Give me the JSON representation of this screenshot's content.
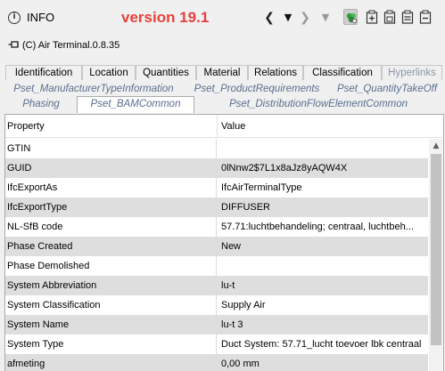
{
  "header": {
    "title": "INFO",
    "version": "version 19.1",
    "nav": {
      "back_glyph": "❮",
      "dropdown1_glyph": "▼",
      "forward_glyph": "❯",
      "dropdown2_glyph": "▼"
    },
    "tool_icons": [
      "color-picker-icon",
      "add-property-icon",
      "save-icon",
      "print-icon",
      "delete-icon"
    ]
  },
  "element": {
    "icon": "air-terminal-icon",
    "name": "(C) Air Terminal.0.8.35"
  },
  "tabs": {
    "row1": [
      "Identification",
      "Location",
      "Quantities",
      "Material",
      "Relations",
      "Classification",
      "Hyperlinks"
    ],
    "row2": [
      "Pset_ManufacturerTypeInformation",
      "Pset_ProductRequirements",
      "Pset_QuantityTakeOff"
    ],
    "row3": [
      "Phasing",
      "Pset_BAMCommon",
      "Pset_DistributionFlowElementCommon"
    ],
    "selected": "Pset_BAMCommon"
  },
  "table": {
    "columns": [
      "Property",
      "Value"
    ],
    "rows": [
      {
        "property": "GTIN",
        "value": ""
      },
      {
        "property": "GUID",
        "value": "0lNnw2$7L1x8aJz8yAQW4X"
      },
      {
        "property": "IfcExportAs",
        "value": "IfcAirTerminalType"
      },
      {
        "property": "IfcExportType",
        "value": "DIFFUSER"
      },
      {
        "property": "NL-SfB code",
        "value": "57.71:luchtbehandeling; centraal, luchtbeh..."
      },
      {
        "property": "Phase Created",
        "value": "New"
      },
      {
        "property": "Phase Demolished",
        "value": ""
      },
      {
        "property": "System Abbreviation",
        "value": "lu-t"
      },
      {
        "property": "System Classification",
        "value": "Supply Air"
      },
      {
        "property": "System Name",
        "value": "lu-t 3"
      },
      {
        "property": "System Type",
        "value": "Duct System: 57.71_lucht toevoer lbk centraal"
      },
      {
        "property": "afmeting",
        "value": "0,00 mm"
      }
    ]
  },
  "scrollbar": {
    "up_glyph": "▲"
  },
  "colors": {
    "version": "#e8413c",
    "pset_tab_text": "#5a6f8f",
    "row_alt": "#dedede",
    "active_tool_bg": "#cfcfcf"
  }
}
